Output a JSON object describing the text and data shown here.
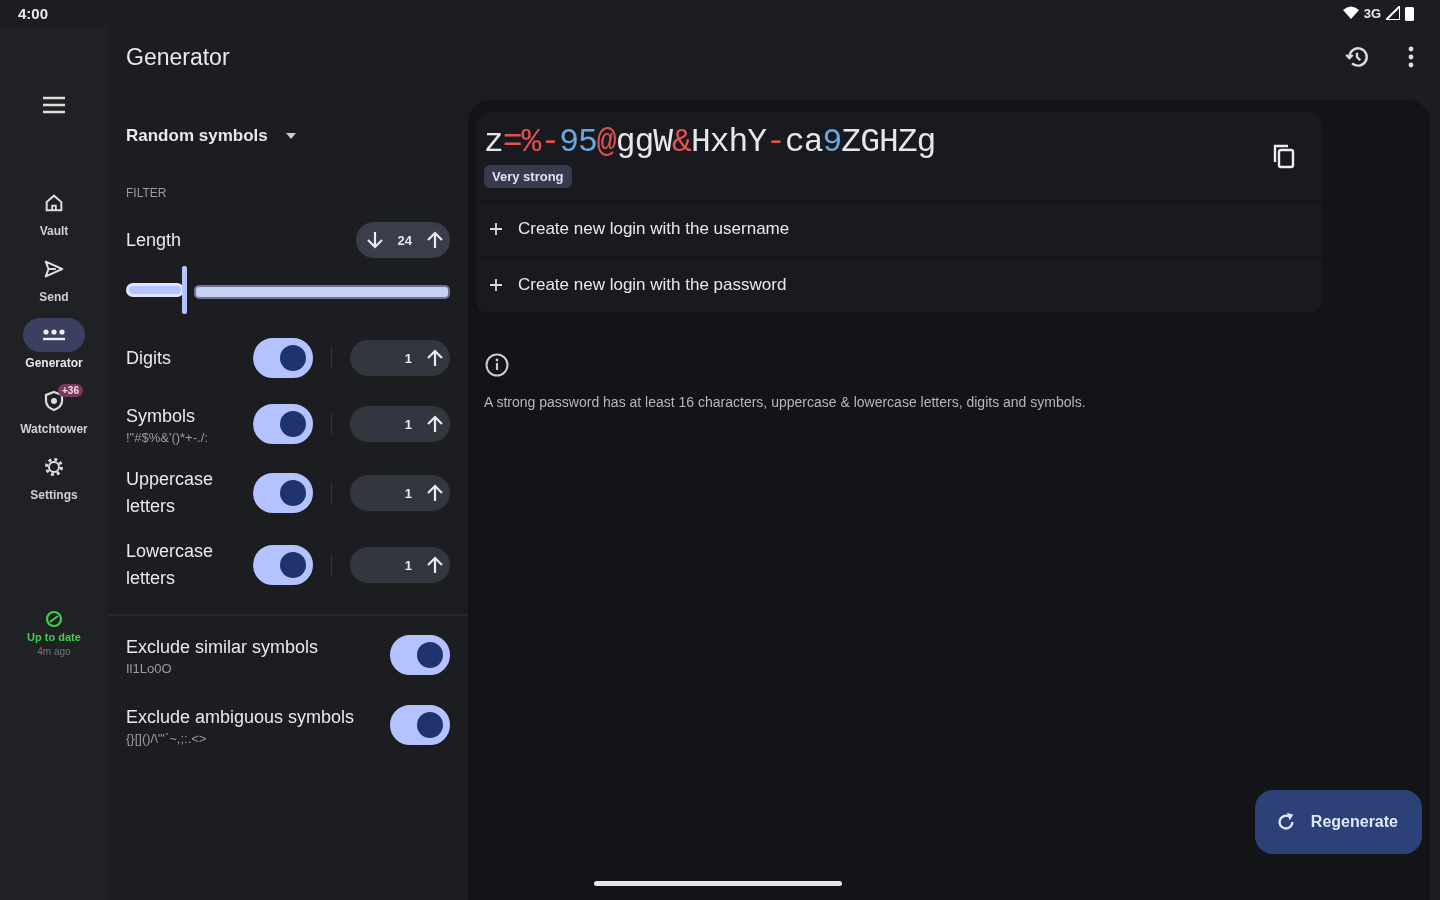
{
  "status_bar": {
    "time": "4:00",
    "network": "3G"
  },
  "rail": {
    "items": [
      {
        "label": "Vault",
        "kind": "home",
        "selected": false
      },
      {
        "label": "Send",
        "kind": "send",
        "selected": false
      },
      {
        "label": "Generator",
        "kind": "dots",
        "selected": true
      },
      {
        "label": "Watchtower",
        "kind": "shield",
        "selected": false,
        "badge": "+36"
      },
      {
        "label": "Settings",
        "kind": "gear",
        "selected": false
      }
    ],
    "sync": {
      "label": "Up to date",
      "time": "4m ago"
    }
  },
  "header": {
    "title": "Generator"
  },
  "type_selector": {
    "label": "Random symbols"
  },
  "filter": {
    "heading": "FILTER",
    "length": {
      "label": "Length",
      "value": "24",
      "level": 0.18
    },
    "options": [
      {
        "label": "Digits",
        "on": true,
        "count": "1"
      },
      {
        "label": "Symbols",
        "sublabel": "!\"#$%&'()*+-./:",
        "on": true,
        "count": "1"
      },
      {
        "label": "Uppercase letters",
        "on": true,
        "count": "1"
      },
      {
        "label": "Lowercase letters",
        "on": true,
        "count": "1"
      }
    ],
    "excludes": [
      {
        "label": "Exclude similar symbols",
        "sublabel": "Il1Lo0O",
        "on": true
      },
      {
        "label": "Exclude ambiguous symbols",
        "sublabel": "{}[]()/\\'\"`~,;:.<>",
        "on": true
      }
    ]
  },
  "result": {
    "password": [
      {
        "text": "z",
        "kind": "letter"
      },
      {
        "text": "=%-",
        "kind": "symbol"
      },
      {
        "text": "95",
        "kind": "digit"
      },
      {
        "text": "@",
        "kind": "symbol"
      },
      {
        "text": "ggW",
        "kind": "letter"
      },
      {
        "text": "&",
        "kind": "symbol"
      },
      {
        "text": "HxhY",
        "kind": "letter"
      },
      {
        "text": "-",
        "kind": "symbol"
      },
      {
        "text": "ca",
        "kind": "letter"
      },
      {
        "text": "9",
        "kind": "digit"
      },
      {
        "text": "ZGHZg",
        "kind": "letter"
      }
    ],
    "strength": "Very strong",
    "actions": [
      "Create new login with the username",
      "Create new login with the password"
    ]
  },
  "tip": "A strong password has at least 16 characters, uppercase & lowercase letters, digits and symbols.",
  "regenerate_button": "Regenerate"
}
